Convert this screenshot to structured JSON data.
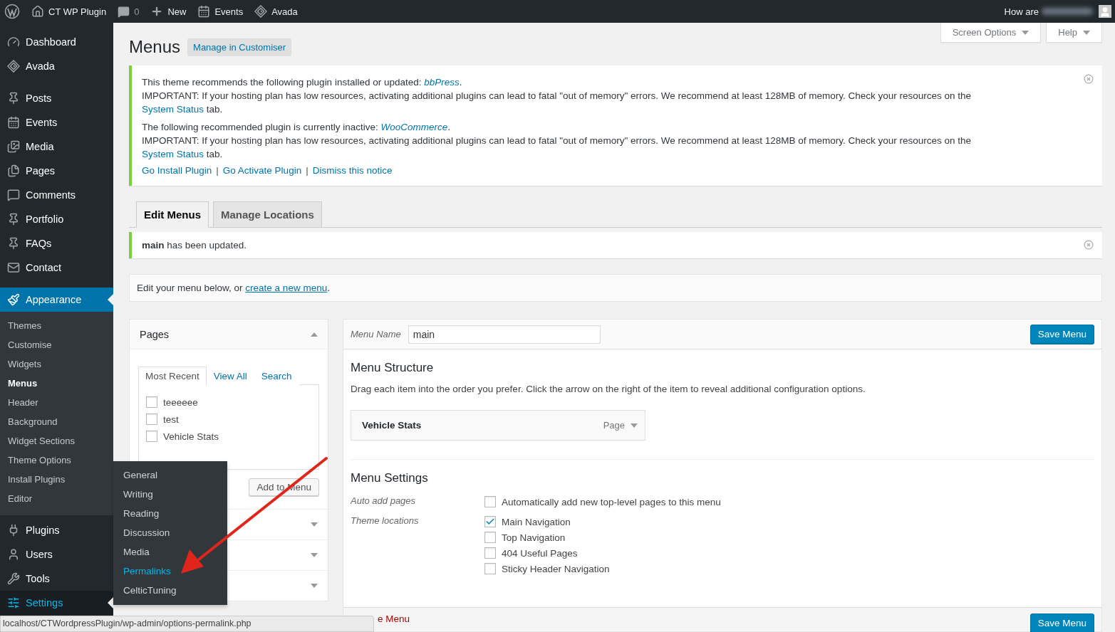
{
  "admin_bar": {
    "items": [
      {
        "label": "CT WP Plugin"
      },
      {
        "label": "0"
      },
      {
        "label": "New"
      },
      {
        "label": "Events"
      },
      {
        "label": "Avada"
      }
    ],
    "greeting": "How are"
  },
  "sidebar": {
    "groups": [
      [
        {
          "label": "Dashboard",
          "selected": false
        },
        {
          "label": "Avada",
          "selected": false
        }
      ],
      [
        {
          "label": "Posts",
          "selected": false
        },
        {
          "label": "Events",
          "selected": false
        },
        {
          "label": "Media",
          "selected": false
        },
        {
          "label": "Pages",
          "selected": false
        },
        {
          "label": "Comments",
          "selected": false
        },
        {
          "label": "Portfolio",
          "selected": false
        },
        {
          "label": "FAQs",
          "selected": false
        },
        {
          "label": "Contact",
          "selected": false
        }
      ],
      [
        {
          "label": "Appearance",
          "selected": true,
          "submenu": [
            {
              "label": "Themes",
              "selected": false
            },
            {
              "label": "Customise",
              "selected": false
            },
            {
              "label": "Widgets",
              "selected": false
            },
            {
              "label": "Menus",
              "selected": true
            },
            {
              "label": "Header",
              "selected": false
            },
            {
              "label": "Background",
              "selected": false
            },
            {
              "label": "Widget Sections",
              "selected": false
            },
            {
              "label": "Theme Options",
              "selected": false
            },
            {
              "label": "Install Plugins",
              "selected": false
            },
            {
              "label": "Editor",
              "selected": false
            }
          ]
        },
        {
          "label": "Plugins",
          "selected": false
        },
        {
          "label": "Users",
          "selected": false
        },
        {
          "label": "Tools",
          "selected": false
        },
        {
          "label": "Settings",
          "selected": false,
          "hovered": true,
          "flyout": [
            {
              "label": "General",
              "hovered": false
            },
            {
              "label": "Writing",
              "hovered": false
            },
            {
              "label": "Reading",
              "hovered": false
            },
            {
              "label": "Discussion",
              "hovered": false
            },
            {
              "label": "Media",
              "hovered": false
            },
            {
              "label": "Permalinks",
              "hovered": true
            },
            {
              "label": "CelticTuning",
              "hovered": false
            }
          ]
        }
      ]
    ]
  },
  "screen_meta": [
    "Screen Options",
    "Help"
  ],
  "title": "Menus",
  "title_action": "Manage in Customiser",
  "notice": {
    "paragraphs": [
      [
        {
          "kind": "text",
          "text": "This theme recommends the following plugin installed or updated: "
        },
        {
          "kind": "em_link",
          "text": "bbPress"
        },
        {
          "kind": "text",
          "text": "."
        },
        {
          "kind": "break"
        },
        {
          "kind": "text",
          "text": "IMPORTANT: If your hosting plan has low resources, activating additional plugins can lead to fatal \"out of memory\" errors. We recommend at least 128MB of memory. Check your resources on the "
        },
        {
          "kind": "link",
          "text": "System Status"
        },
        {
          "kind": "text",
          "text": " tab."
        }
      ],
      [
        {
          "kind": "text",
          "text": "The following recommended plugin is currently inactive: "
        },
        {
          "kind": "em_link",
          "text": "WooCommerce"
        },
        {
          "kind": "text",
          "text": "."
        },
        {
          "kind": "break"
        },
        {
          "kind": "text",
          "text": "IMPORTANT: If your hosting plan has low resources, activating additional plugins can lead to fatal \"out of memory\" errors. We recommend at least 128MB of memory. Check your resources on the "
        },
        {
          "kind": "link",
          "text": "System Status"
        },
        {
          "kind": "text",
          "text": " tab."
        }
      ]
    ],
    "actions": [
      "Go Install Plugin",
      "Go Activate Plugin",
      "Dismiss this notice"
    ],
    "separator": "|"
  },
  "tabs": [
    {
      "label": "Edit Menus",
      "selected": true
    },
    {
      "label": "Manage Locations",
      "selected": false
    }
  ],
  "updated_notice": "**main** has been updated.",
  "intro": {
    "text": "Edit your menu below, or ",
    "link": "create a new menu",
    "after": "."
  },
  "pages_panel": {
    "title": "Pages",
    "expanded": true,
    "tabs": [
      {
        "label": "Most Recent",
        "selected": true
      },
      {
        "label": "View All",
        "selected": false
      },
      {
        "label": "Search",
        "selected": false
      }
    ],
    "items": [
      {
        "label": "teeeeee",
        "checked": false
      },
      {
        "label": "test",
        "checked": false
      },
      {
        "label": "Vehicle Stats",
        "checked": false
      }
    ],
    "button": "Add to Menu",
    "sections": [
      {
        "expanded": false
      },
      {
        "expanded": false
      },
      {
        "expanded": false
      }
    ]
  },
  "menu_editor": {
    "name_label": "Menu Name",
    "name_value": "main",
    "save": "Save Menu",
    "structure_title": "Menu Structure",
    "structure_hint": "Drag each item into the order you prefer. Click the arrow on the right of the item to reveal additional configuration options.",
    "items": [
      {
        "title": "Vehicle Stats",
        "type": "Page"
      }
    ],
    "settings_title": "Menu Settings",
    "settings": [
      {
        "label": "Auto add pages",
        "options": [
          {
            "label": "Automatically add new top-level pages to this menu",
            "checked": false
          }
        ]
      },
      {
        "label": "Theme locations",
        "options": [
          {
            "label": "Main Navigation",
            "checked": true
          },
          {
            "label": "Top Navigation",
            "checked": false
          },
          {
            "label": "404 Useful Pages",
            "checked": false
          },
          {
            "label": "Sticky Header Navigation",
            "checked": false
          }
        ]
      }
    ],
    "delete_link": "e Menu",
    "footer_save": "Save Menu"
  },
  "status_url": "localhost/CTWordpressPlugin/wp-admin/options-permalink.php"
}
